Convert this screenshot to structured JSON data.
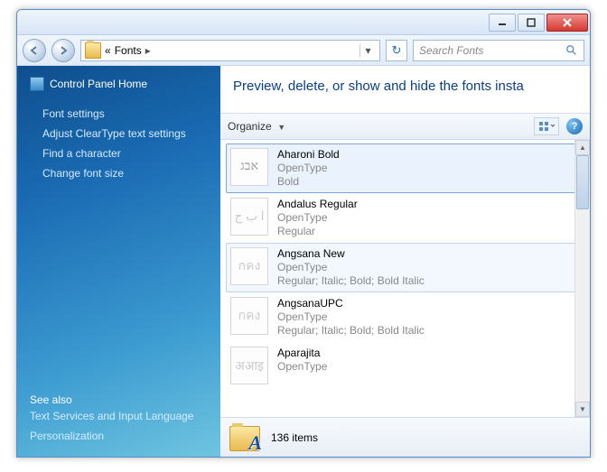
{
  "breadcrumb": {
    "prefix": "«",
    "label": "Fonts",
    "chevron": "▸"
  },
  "search": {
    "placeholder": "Search Fonts"
  },
  "sidebar": {
    "home": "Control Panel Home",
    "links": [
      "Font settings",
      "Adjust ClearType text settings",
      "Find a character",
      "Change font size"
    ],
    "see_also_label": "See also",
    "see_also": [
      "Text Services and Input Language",
      "Personalization"
    ]
  },
  "header_text": "Preview, delete, or show and hide the fonts insta",
  "toolbar": {
    "organize": "Organize"
  },
  "fonts": [
    {
      "name": "Aharoni Bold",
      "type": "OpenType",
      "style": "Bold",
      "glyph": "אבג",
      "state": "selected",
      "stack": false
    },
    {
      "name": "Andalus Regular",
      "type": "OpenType",
      "style": "Regular",
      "glyph": "ا ب ج",
      "state": "",
      "stack": false,
      "dim": true
    },
    {
      "name": "Angsana New",
      "type": "OpenType",
      "style": "Regular; Italic; Bold; Bold Italic",
      "glyph": "กคง",
      "state": "hover",
      "stack": true,
      "dim": true
    },
    {
      "name": "AngsanaUPC",
      "type": "OpenType",
      "style": "Regular; Italic; Bold; Bold Italic",
      "glyph": "กคง",
      "state": "",
      "stack": true,
      "dim": true
    },
    {
      "name": "Aparajita",
      "type": "OpenType",
      "style": "",
      "glyph": "अआइ",
      "state": "",
      "stack": true,
      "dim": true
    }
  ],
  "status": {
    "count": "136 items"
  }
}
